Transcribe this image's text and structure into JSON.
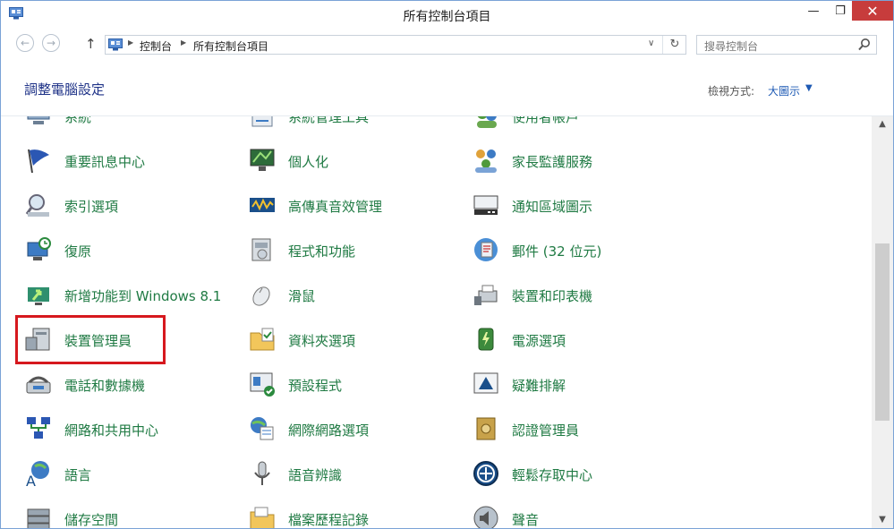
{
  "window": {
    "title": "所有控制台項目",
    "min_glyph": "—",
    "max_glyph": "❐",
    "close_glyph": "✕"
  },
  "navbar": {
    "back_glyph": "←",
    "forward_glyph": "→",
    "up_glyph": "↑",
    "breadcrumbs": [
      "控制台",
      "所有控制台項目"
    ],
    "separator": "▶",
    "dropdown_glyph": "∨",
    "refresh_glyph": "↻",
    "search_placeholder": "搜尋控制台"
  },
  "header": {
    "title": "調整電腦設定",
    "view_label": "檢視方式:",
    "view_value": "大圖示",
    "view_caret": "▼"
  },
  "items": [
    {
      "label": "系統",
      "icon": "system-icon"
    },
    {
      "label": "系統管理工具",
      "icon": "admin-tools-icon"
    },
    {
      "label": "使用者帳戶",
      "icon": "user-accounts-icon"
    },
    {
      "label": "重要訊息中心",
      "icon": "action-center-flag-icon"
    },
    {
      "label": "個人化",
      "icon": "personalization-icon"
    },
    {
      "label": "家長監護服務",
      "icon": "family-safety-icon"
    },
    {
      "label": "索引選項",
      "icon": "indexing-options-icon"
    },
    {
      "label": "高傳真音效管理",
      "icon": "hd-audio-icon"
    },
    {
      "label": "通知區域圖示",
      "icon": "notification-area-icon"
    },
    {
      "label": "復原",
      "icon": "recovery-icon"
    },
    {
      "label": "程式和功能",
      "icon": "programs-features-icon"
    },
    {
      "label": "郵件 (32 位元)",
      "icon": "mail-icon"
    },
    {
      "label": "新增功能到 Windows 8.1",
      "icon": "add-features-icon"
    },
    {
      "label": "滑鼠",
      "icon": "mouse-icon"
    },
    {
      "label": "裝置和印表機",
      "icon": "devices-printers-icon"
    },
    {
      "label": "裝置管理員",
      "icon": "device-manager-icon"
    },
    {
      "label": "資料夾選項",
      "icon": "folder-options-icon"
    },
    {
      "label": "電源選項",
      "icon": "power-options-icon"
    },
    {
      "label": "電話和數據機",
      "icon": "phone-modem-icon"
    },
    {
      "label": "預設程式",
      "icon": "default-programs-icon"
    },
    {
      "label": "疑難排解",
      "icon": "troubleshooting-icon"
    },
    {
      "label": "網路和共用中心",
      "icon": "network-sharing-icon"
    },
    {
      "label": "網際網路選項",
      "icon": "internet-options-icon"
    },
    {
      "label": "認證管理員",
      "icon": "credential-manager-icon"
    },
    {
      "label": "語言",
      "icon": "language-icon"
    },
    {
      "label": "語音辨識",
      "icon": "speech-recognition-icon"
    },
    {
      "label": "輕鬆存取中心",
      "icon": "ease-of-access-icon"
    },
    {
      "label": "儲存空間",
      "icon": "storage-spaces-icon"
    },
    {
      "label": "檔案歷程記錄",
      "icon": "file-history-icon"
    },
    {
      "label": "聲音",
      "icon": "sound-icon"
    }
  ],
  "scrollbar": {
    "up_glyph": "▲",
    "down_glyph": "▼",
    "position_fraction": 0.55
  },
  "colors": {
    "item_text": "#1f7a43",
    "title_text": "#1e3287",
    "link": "#1e5ab4",
    "highlight_box": "#d6181e",
    "close_button": "#c73c3c"
  }
}
